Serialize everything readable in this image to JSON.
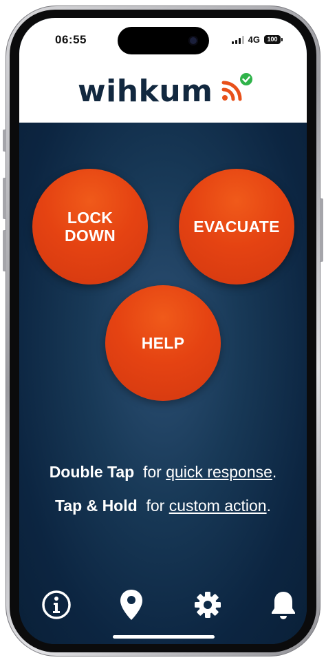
{
  "status_bar": {
    "time": "06:55",
    "network": "4G",
    "battery": "100"
  },
  "header": {
    "logo_text": "wihkum",
    "brand_color": "#12283f",
    "accent_color": "#e8501a",
    "check_color": "#2fb34a"
  },
  "actions": {
    "lockdown_label": "LOCK\nDOWN",
    "evacuate_label": "EVACUATE",
    "help_label": "HELP",
    "button_color": "#e54312"
  },
  "instructions": {
    "line1_bold": "Double Tap",
    "line1_for": "for",
    "line1_link": "quick response",
    "line1_end": ".",
    "line2_bold": "Tap & Hold",
    "line2_for": "for",
    "line2_link": "custom action",
    "line2_end": "."
  },
  "tabbar": {
    "items": [
      {
        "icon": "info-icon"
      },
      {
        "icon": "location-pin-icon"
      },
      {
        "icon": "gear-icon"
      },
      {
        "icon": "bell-icon"
      }
    ]
  },
  "theme": {
    "background": "#0e2a47"
  }
}
